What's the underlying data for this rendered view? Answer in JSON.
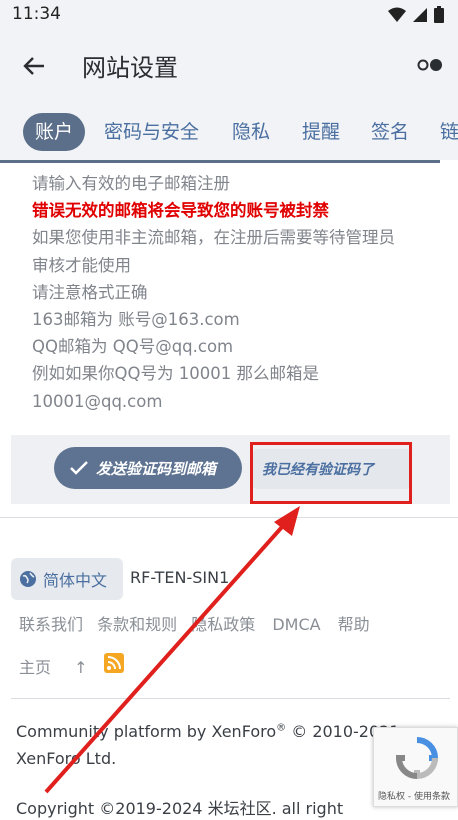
{
  "status_bar": {
    "time": "11:34"
  },
  "app_bar": {
    "title": "网站设置"
  },
  "tabs": [
    "账户",
    "密码与安全",
    "隐私",
    "提醒",
    "签名",
    "链"
  ],
  "notice": {
    "line1": "请输入有效的电子邮箱注册",
    "warning": "错误无效的邮箱将会导致您的账号被封禁",
    "line3": "如果您使用非主流邮箱，在注册后需要等待管理员",
    "line4": "审核才能使用",
    "line5": "请注意格式正确",
    "line6": "163邮箱为 账号@163.com",
    "line7": "QQ邮箱为 QQ号@qq.com",
    "line8": "例如如果你QQ号为 10001 那么邮箱是",
    "line9": "10001@qq.com"
  },
  "actions": {
    "send_label": "发送验证码到邮箱",
    "have_code_label": "我已经有验证码了"
  },
  "footer": {
    "language": "简体中文",
    "style": "RF-TEN-SIN1",
    "links": [
      "联系我们",
      "条款和规则",
      "隐私政策",
      "DMCA",
      "帮助"
    ],
    "home": "主页",
    "up": "↑",
    "copyright1_pre": "Community platform by XenForo",
    "copyright1_sup": "®",
    "copyright1_post": " © 2010-2021",
    "copyright2": "XenForo Ltd.",
    "copyright3": "Copyright ©2019-2024 米坛社区. all right"
  },
  "recaptcha": {
    "text": "隐私权 - 使用条款"
  },
  "colors": {
    "accent": "#5b6f8a",
    "warning": "#e00000",
    "highlight": "#e0201d"
  }
}
